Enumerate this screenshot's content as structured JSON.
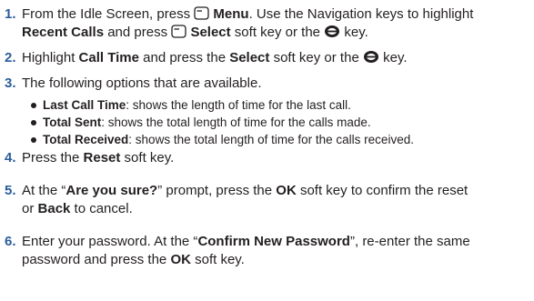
{
  "steps": [
    {
      "number": "1.",
      "l1": {
        "a": "From the Idle Screen, press ",
        "b": "Menu",
        "c": ". Use the Navigation keys to highlight"
      },
      "l2": {
        "a": "Recent Calls",
        "b": " and press ",
        "c": "Select",
        "d": " soft key or the ",
        "e": " key."
      }
    },
    {
      "number": "2.",
      "l1": {
        "a": "Highlight ",
        "b": "Call Time",
        "c": " and press the ",
        "d": "Select",
        "e": " soft key or the ",
        "f": " key."
      }
    },
    {
      "number": "3.",
      "l1": {
        "a": "The following options that are available."
      }
    },
    {
      "number": "4.",
      "l1": {
        "a": "Press the ",
        "b": "Reset",
        "c": " soft key."
      }
    },
    {
      "number": "5.",
      "l1": {
        "a": "At the “",
        "b": "Are you sure?",
        "c": "” prompt, press the ",
        "d": "OK",
        "e": " soft key to confirm the reset"
      },
      "l2": {
        "a": "or ",
        "b": "Back",
        "c": " to cancel."
      }
    },
    {
      "number": "6.",
      "l1": {
        "a": "Enter your password. At the “",
        "b": "Confirm New Password",
        "c": "”, re-enter the same"
      },
      "l2": {
        "a": "password and press the ",
        "b": "OK",
        "c": " soft key."
      }
    }
  ],
  "options": [
    {
      "term": "Last Call Time",
      "desc": ": shows the length of time for the last call."
    },
    {
      "term": "Total Sent",
      "desc": ": shows the total length of time for the calls made."
    },
    {
      "term": "Total Received",
      "desc": ": shows the total length of time for the calls received."
    }
  ],
  "icons": {
    "left_softkey": "left-soft-key-icon",
    "select_key": "ok-select-key-icon"
  }
}
